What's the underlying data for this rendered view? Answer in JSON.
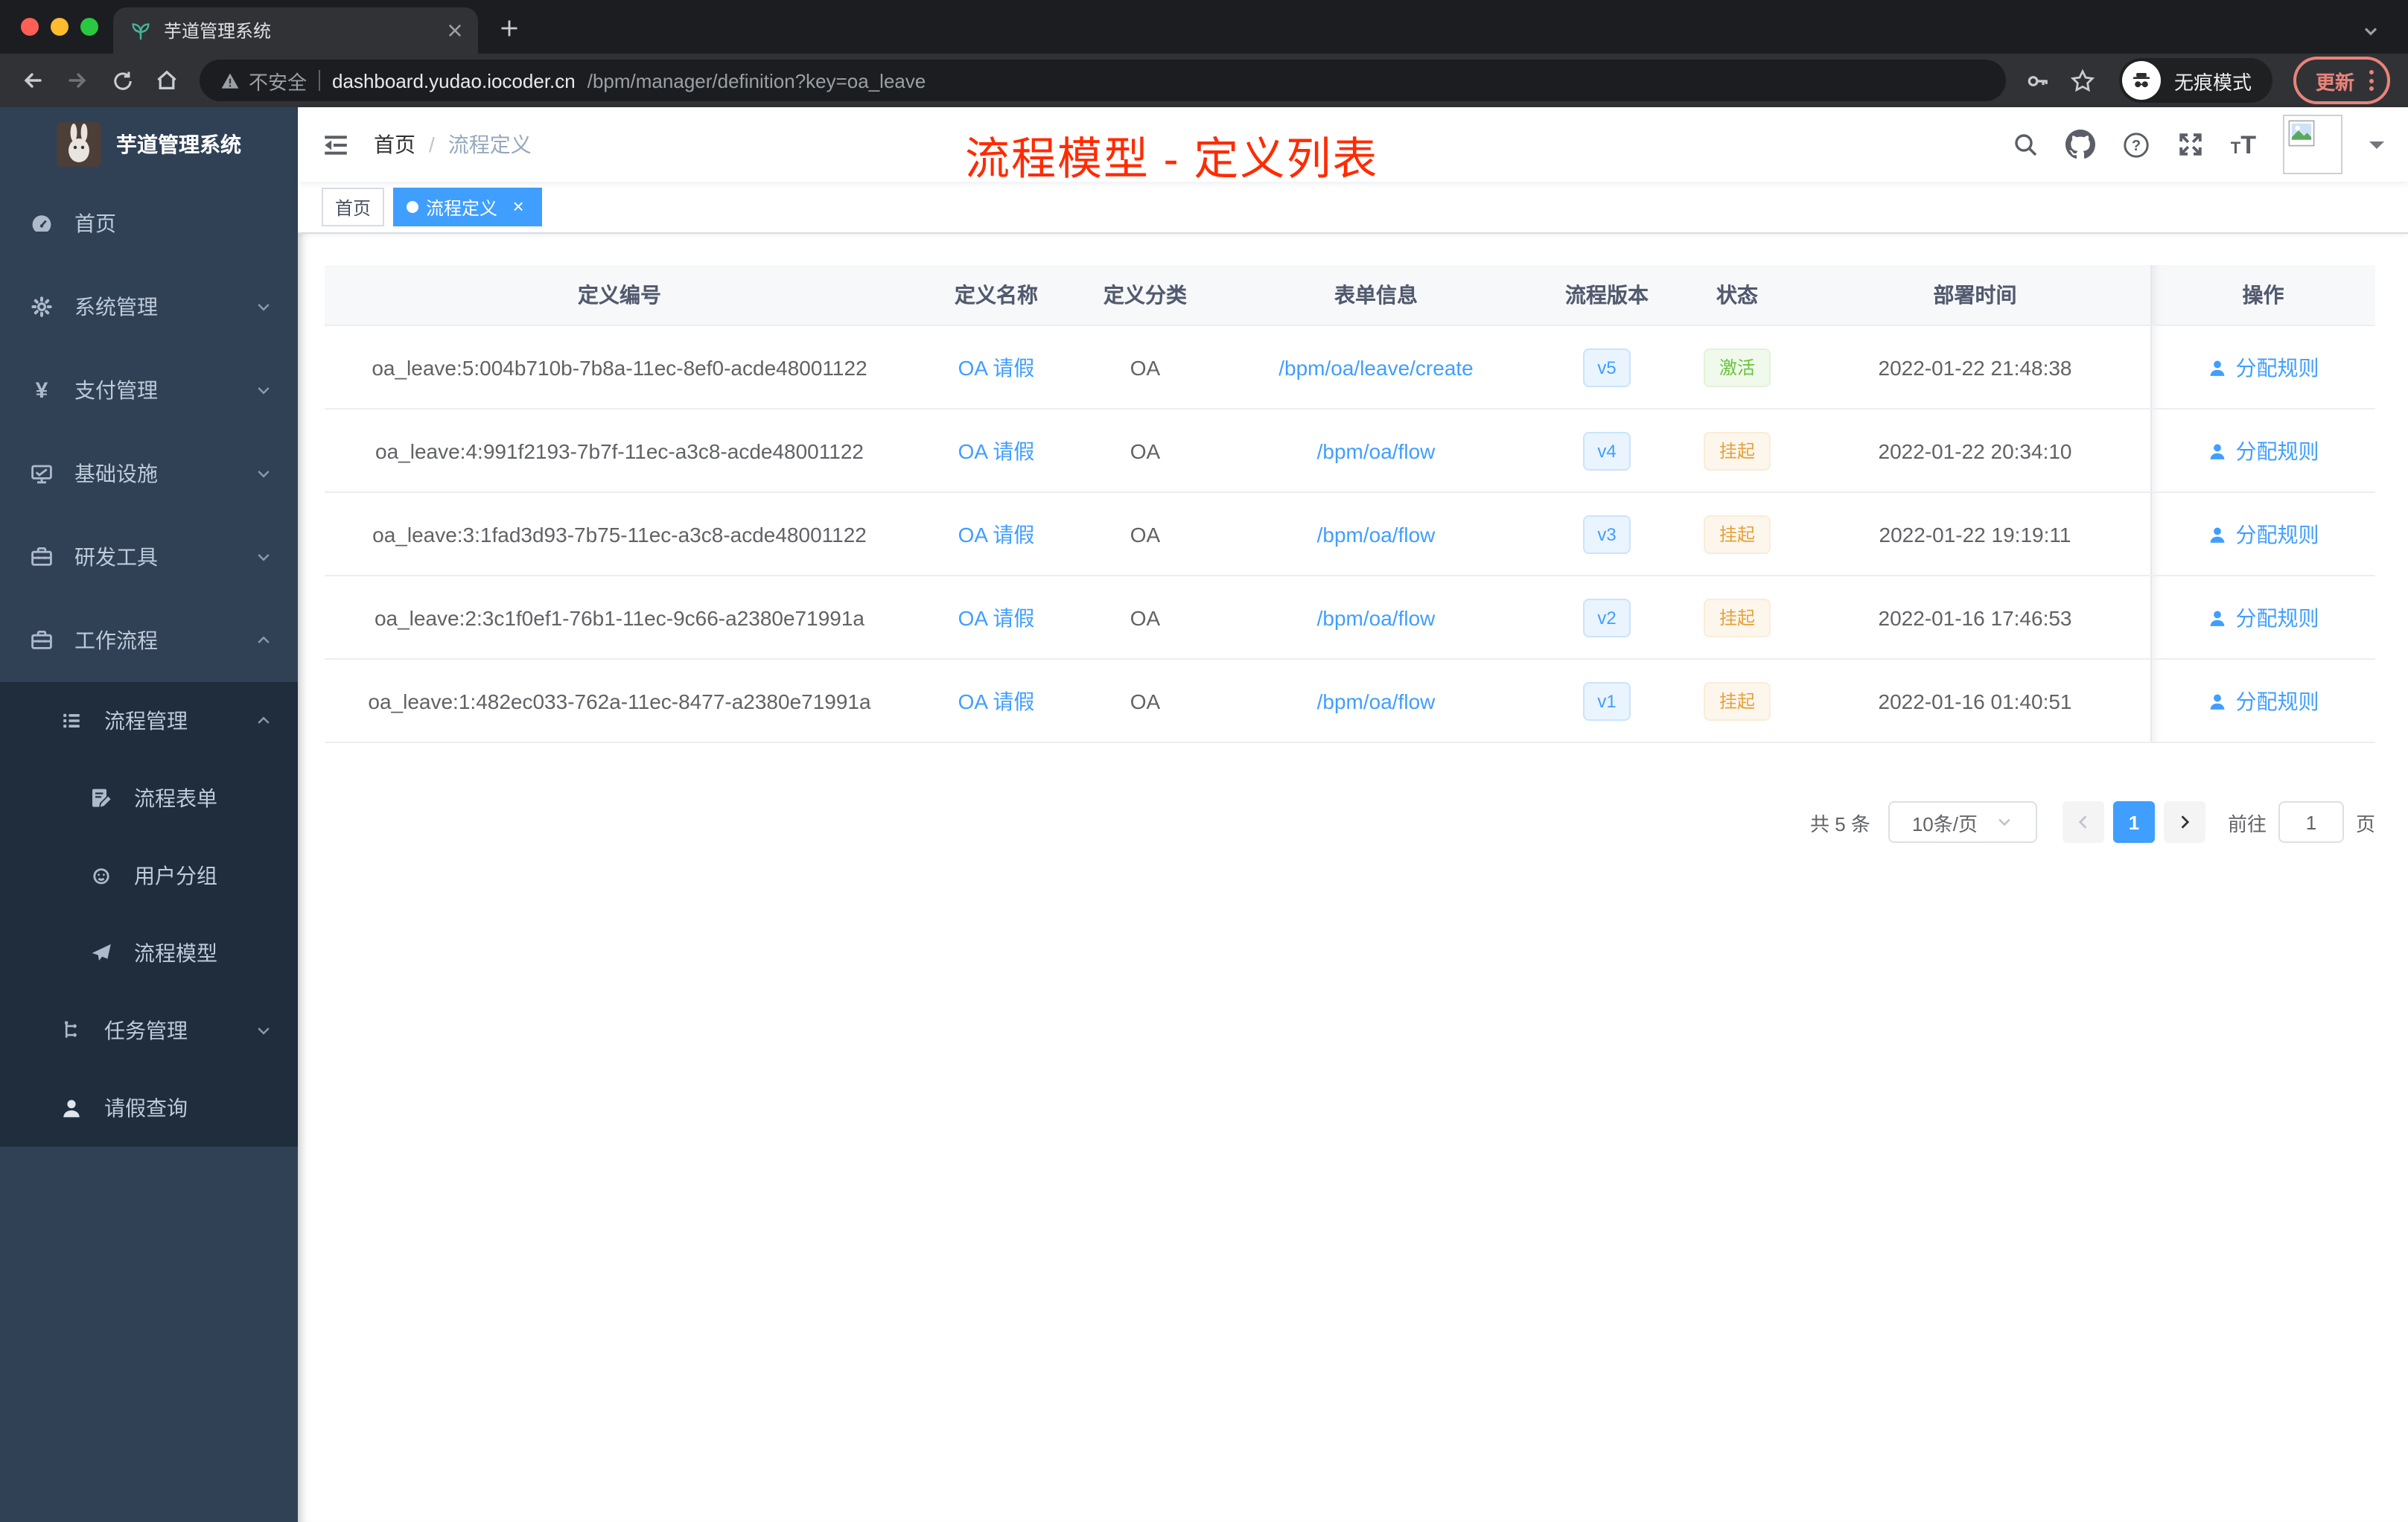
{
  "browser": {
    "tab": {
      "title": "芋道管理系统"
    },
    "toolbar": {
      "security_label": "不安全",
      "url_host": "dashboard.yudao.iocoder.cn",
      "url_path": "/bpm/manager/definition?key=oa_leave",
      "incognito_label": "无痕模式",
      "update_label": "更新"
    }
  },
  "sidebar": {
    "app_title": "芋道管理系统",
    "items": [
      {
        "label": "首页",
        "level": 1
      },
      {
        "label": "系统管理",
        "level": 1,
        "expandable": true
      },
      {
        "label": "支付管理",
        "level": 1,
        "expandable": true
      },
      {
        "label": "基础设施",
        "level": 1,
        "expandable": true
      },
      {
        "label": "研发工具",
        "level": 1,
        "expandable": true
      },
      {
        "label": "工作流程",
        "level": 1,
        "expandable": true,
        "expanded": true
      },
      {
        "label": "流程管理",
        "level": 2,
        "expandable": true,
        "expanded": true
      },
      {
        "label": "流程表单",
        "level": 3
      },
      {
        "label": "用户分组",
        "level": 3
      },
      {
        "label": "流程模型",
        "level": 3
      },
      {
        "label": "任务管理",
        "level": 2,
        "expandable": true
      },
      {
        "label": "请假查询",
        "level": 2
      }
    ]
  },
  "navbar": {
    "breadcrumb_home": "首页",
    "breadcrumb_separator": "/",
    "breadcrumb_current": "流程定义"
  },
  "annotation": {
    "text": "流程模型 - 定义列表",
    "color": "#ff2b00"
  },
  "tags": {
    "items": [
      {
        "label": "首页",
        "active": false
      },
      {
        "label": "流程定义",
        "active": true
      }
    ]
  },
  "table": {
    "headers": [
      "定义编号",
      "定义名称",
      "定义分类",
      "表单信息",
      "流程版本",
      "状态",
      "部署时间",
      "操作"
    ],
    "action_label": "分配规则",
    "rows": [
      {
        "id": "oa_leave:5:004b710b-7b8a-11ec-8ef0-acde48001122",
        "name": "OA 请假",
        "category": "OA",
        "form": "/bpm/oa/leave/create",
        "version": "v5",
        "status": "激活",
        "status_type": "active",
        "time": "2022-01-22 21:48:38"
      },
      {
        "id": "oa_leave:4:991f2193-7b7f-11ec-a3c8-acde48001122",
        "name": "OA 请假",
        "category": "OA",
        "form": "/bpm/oa/flow",
        "version": "v4",
        "status": "挂起",
        "status_type": "suspended",
        "time": "2022-01-22 20:34:10"
      },
      {
        "id": "oa_leave:3:1fad3d93-7b75-11ec-a3c8-acde48001122",
        "name": "OA 请假",
        "category": "OA",
        "form": "/bpm/oa/flow",
        "version": "v3",
        "status": "挂起",
        "status_type": "suspended",
        "time": "2022-01-22 19:19:11"
      },
      {
        "id": "oa_leave:2:3c1f0ef1-76b1-11ec-9c66-a2380e71991a",
        "name": "OA 请假",
        "category": "OA",
        "form": "/bpm/oa/flow",
        "version": "v2",
        "status": "挂起",
        "status_type": "suspended",
        "time": "2022-01-16 17:46:53"
      },
      {
        "id": "oa_leave:1:482ec033-762a-11ec-8477-a2380e71991a",
        "name": "OA 请假",
        "category": "OA",
        "form": "/bpm/oa/flow",
        "version": "v1",
        "status": "挂起",
        "status_type": "suspended",
        "time": "2022-01-16 01:40:51"
      }
    ]
  },
  "pagination": {
    "total": "共 5 条",
    "page_size": "10条/页",
    "current_page": "1",
    "jump_prefix": "前往",
    "jump_value": "1",
    "jump_suffix": "页"
  },
  "colors": {
    "accent": "#409eff",
    "annotation_red": "#ff2b00",
    "sidebar_bg": "#304156",
    "sidebar_submenu_bg": "#1f2d3d",
    "status_active_green": "#67c23a",
    "status_suspended_orange": "#e6a23c"
  }
}
